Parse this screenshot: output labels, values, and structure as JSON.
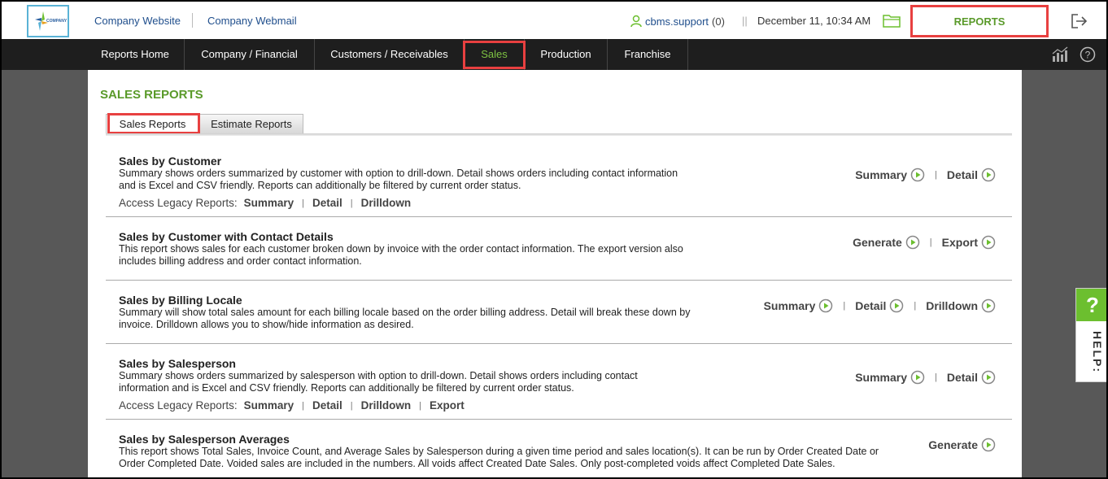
{
  "header": {
    "logo_text": "COMPANY",
    "links": [
      "Company Website",
      "Company Webmail"
    ],
    "user": "cbms.support",
    "user_count": "(0)",
    "separator": "||",
    "datetime": "December 11, 10:34 AM",
    "reports_label": "REPORTS"
  },
  "nav": {
    "items": [
      "Reports Home",
      "Company / Financial",
      "Customers / Receivables",
      "Sales",
      "Production",
      "Franchise"
    ],
    "active": "Sales"
  },
  "page": {
    "title": "SALES REPORTS",
    "tabs": [
      "Sales Reports",
      "Estimate Reports"
    ],
    "active_tab": "Sales Reports"
  },
  "reports": [
    {
      "title": "Sales by Customer",
      "desc1": "Summary shows orders summarized by customer with option to drill-down. Detail shows orders including contact information",
      "desc2": "and is Excel and CSV friendly. Reports can additionally be filtered by current order status.",
      "actions": [
        "Summary",
        "Detail"
      ],
      "legacy_label": "Access Legacy Reports:",
      "legacy": [
        "Summary",
        "Detail",
        "Drilldown"
      ]
    },
    {
      "title": "Sales by Customer with Contact Details",
      "desc1": "This report shows sales for each customer broken down by invoice with the order contact information. The export version also",
      "desc2": "includes billing address and order contact information.",
      "actions": [
        "Generate",
        "Export"
      ]
    },
    {
      "title": "Sales by Billing Locale",
      "desc1": "Summary will show total sales amount for each billing locale based on the order billing address. Detail will break these down by",
      "desc2": "invoice. Drilldown allows you to show/hide information as desired.",
      "actions": [
        "Summary",
        "Detail",
        "Drilldown"
      ]
    },
    {
      "title": "Sales by Salesperson",
      "desc1": "Summary shows orders summarized by salesperson with option to drill-down. Detail shows orders including contact",
      "desc2": "information and is Excel and CSV friendly. Reports can additionally be filtered by current order status.",
      "actions": [
        "Summary",
        "Detail"
      ],
      "legacy_label": "Access Legacy Reports:",
      "legacy": [
        "Summary",
        "Detail",
        "Drilldown",
        "Export"
      ]
    },
    {
      "title": "Sales by Salesperson Averages",
      "desc1": "This report shows Total Sales, Invoice Count, and Average Sales by Salesperson during a given time period and sales location(s). It can be run by Order Created Date or",
      "desc2": "Order Completed Date. Voided sales are included in the numbers. All voids affect Created Date Sales. Only post-completed voids affect Completed Date Sales.",
      "actions": [
        "Generate"
      ]
    }
  ],
  "help": {
    "q": "?",
    "label": "HELP:"
  },
  "colors": {
    "accent_green": "#5a9a2a",
    "highlight_red": "#e84040",
    "nav_bg": "#1e1e1e"
  }
}
